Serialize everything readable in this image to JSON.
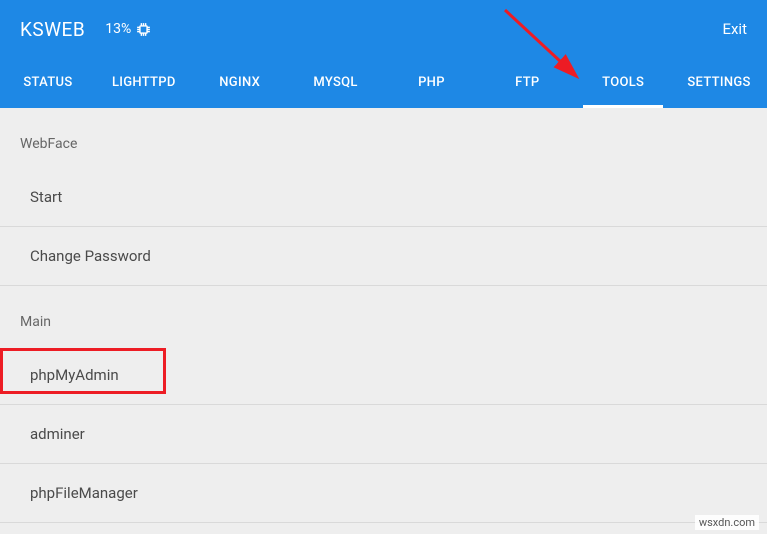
{
  "header": {
    "app_title": "KSWEB",
    "battery_percent": "13%",
    "exit_label": "Exit"
  },
  "tabs": [
    {
      "label": "STATUS",
      "active": false
    },
    {
      "label": "LIGHTTPD",
      "active": false
    },
    {
      "label": "NGINX",
      "active": false
    },
    {
      "label": "MYSQL",
      "active": false
    },
    {
      "label": "PHP",
      "active": false
    },
    {
      "label": "FTP",
      "active": false
    },
    {
      "label": "TOOLS",
      "active": true
    },
    {
      "label": "SETTINGS",
      "active": false
    }
  ],
  "sections": {
    "webface": {
      "label": "WebFace",
      "items": [
        "Start",
        "Change Password"
      ]
    },
    "main": {
      "label": "Main",
      "items": [
        "phpMyAdmin",
        "adminer",
        "phpFileManager"
      ]
    }
  },
  "watermark": "wsxdn.com",
  "annotation": {
    "arrow_color": "#ed1c24",
    "highlight_color": "#ed1c24"
  }
}
